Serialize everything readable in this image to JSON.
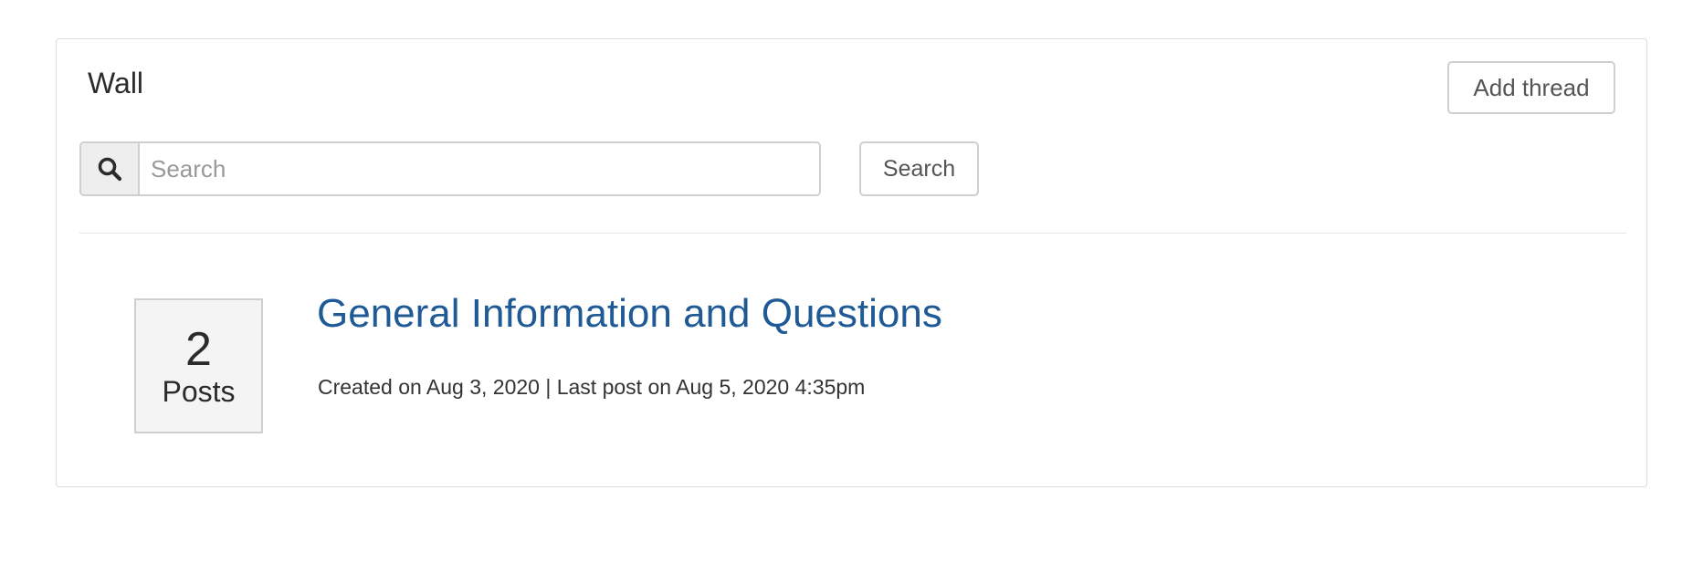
{
  "wall": {
    "title": "Wall",
    "add_thread_label": "Add thread"
  },
  "search": {
    "icon": "search-icon",
    "placeholder": "Search",
    "value": "",
    "button_label": "Search"
  },
  "threads": [
    {
      "post_count": "2",
      "post_count_label": "Posts",
      "title": "General Information and Questions",
      "meta": "Created on Aug 3, 2020 | Last post on Aug 5, 2020 4:35pm"
    }
  ],
  "colors": {
    "link": "#1f5a96",
    "border": "#cfcfcf",
    "count_bg": "#f4f4f4"
  }
}
